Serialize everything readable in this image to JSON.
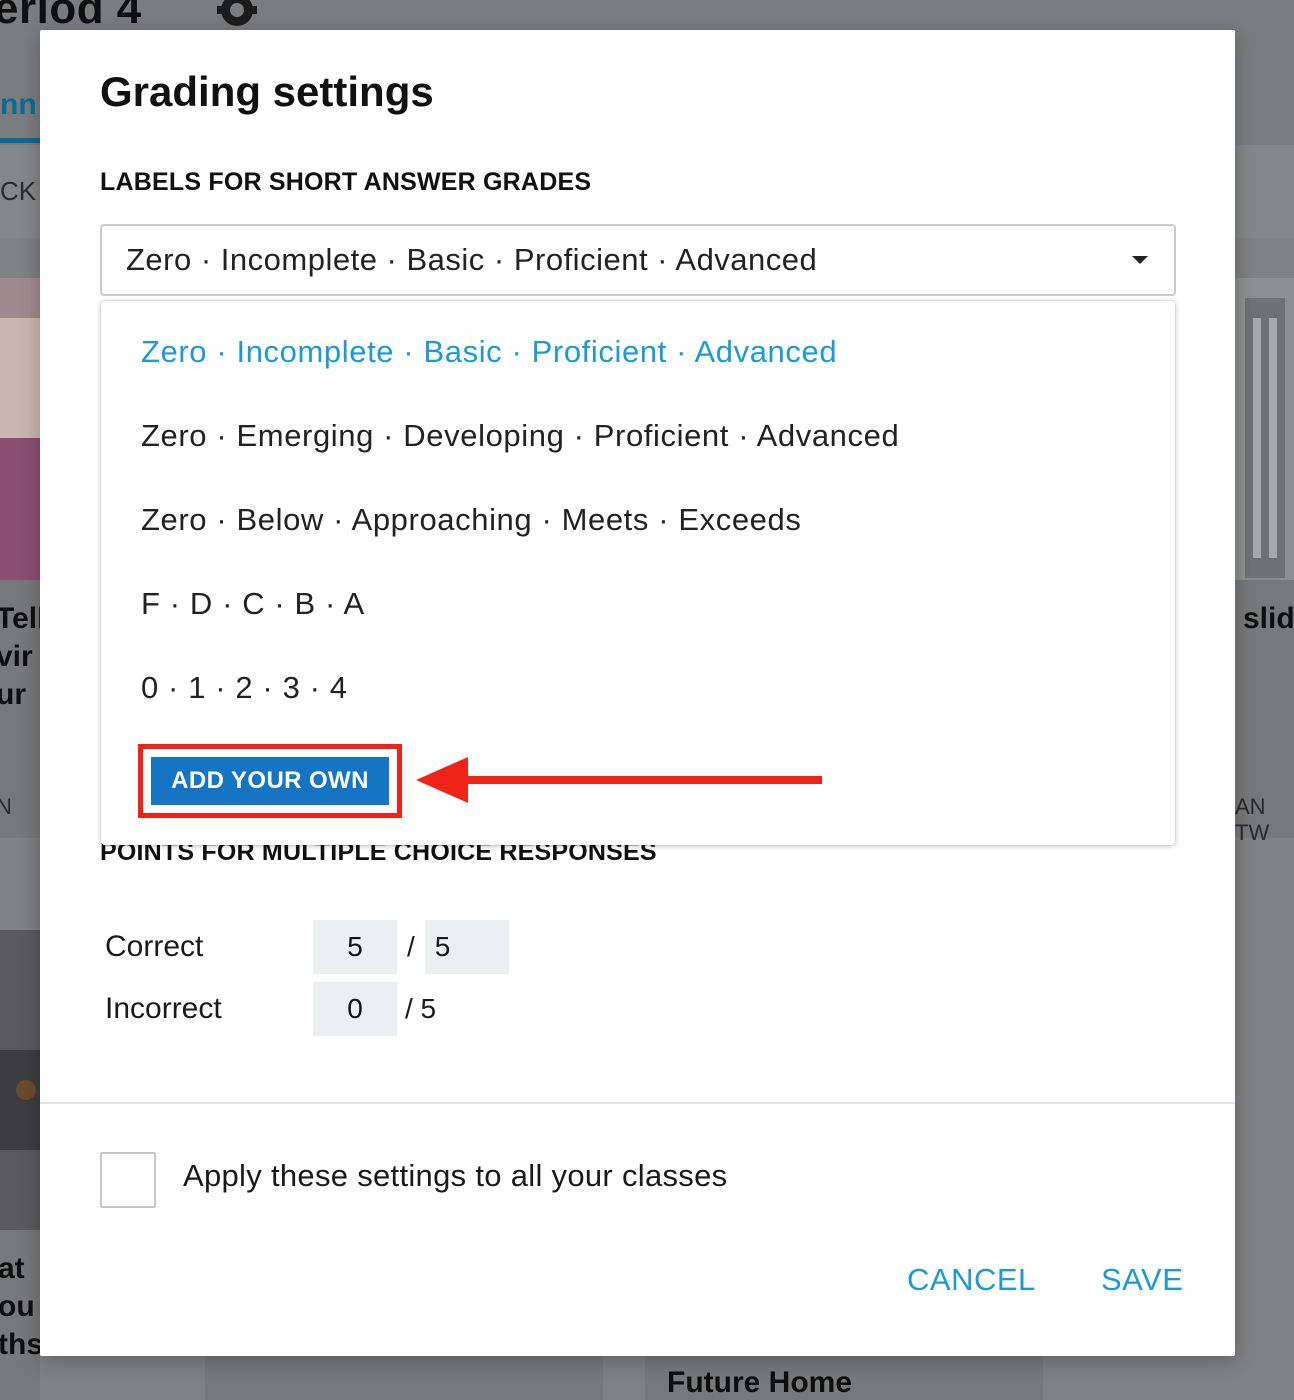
{
  "background": {
    "page_title": "eriod 4",
    "tab_label": "nn",
    "back_label": "CK",
    "left_card_text": [
      "Tell",
      "vir",
      "ur"
    ],
    "right_card_text": "slid",
    "left_card_meta": "N",
    "right_card_meta": "AN TW",
    "bottom_left_text": [
      "at",
      "ou",
      "ths"
    ],
    "bottom_card_title": "Future Home"
  },
  "modal": {
    "title": "Grading settings",
    "labels_section_title": "LABELS FOR SHORT ANSWER GRADES",
    "selected_labels": "Zero · Incomplete · Basic · Proficient · Advanced",
    "points_section_title": "POINTS FOR MULTIPLE CHOICE RESPONSES",
    "points": {
      "correct_label": "Correct",
      "correct_value": "5",
      "correct_max": "5",
      "incorrect_label": "Incorrect",
      "incorrect_value": "0",
      "incorrect_max": "/ 5",
      "separator": "/"
    },
    "apply_label": "Apply these settings to all your classes",
    "cancel_label": "CANCEL",
    "save_label": "SAVE"
  },
  "dropdown": {
    "options": [
      "Zero · Incomplete · Basic · Proficient · Advanced",
      "Zero · Emerging · Developing · Proficient · Advanced",
      "Zero · Below · Approaching · Meets · Exceeds",
      "F · D · C · B · A",
      "0 · 1 · 2 · 3 · 4"
    ],
    "selected_index": 0,
    "add_own_label": "ADD YOUR OWN"
  },
  "colors": {
    "accent": "#1a9ad8",
    "add_button": "#1574c4",
    "highlight": "#ee2418"
  }
}
